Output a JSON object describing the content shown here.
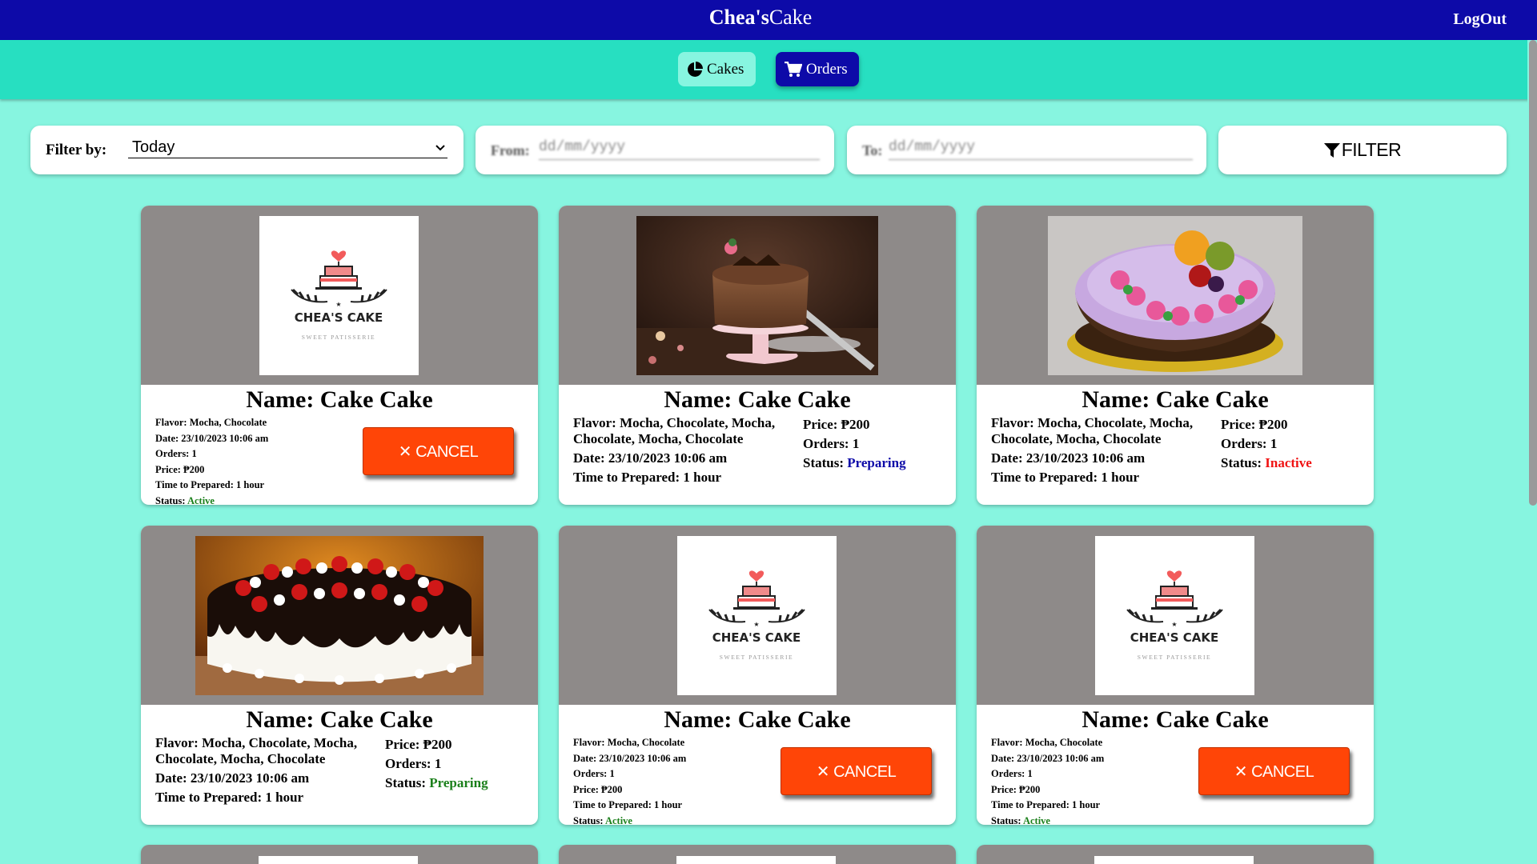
{
  "header": {
    "brand_bold": "Chea's",
    "brand_regular": "Cake",
    "logout_label": "LogOut"
  },
  "nav": {
    "cakes_label": "Cakes",
    "orders_label": "Orders"
  },
  "filters": {
    "filter_by_label": "Filter by:",
    "filter_by_value": "Today",
    "from_label": "From:",
    "from_placeholder": "dd/mm/yyyy",
    "to_label": "To:",
    "to_placeholder": "dd/mm/yyyy",
    "filter_button_label": "FILTER"
  },
  "logo": {
    "title": "CHEA'S CAKE",
    "subtitle": "SWEET PATISSERIE"
  },
  "cards": [
    {
      "name": "Name: Cake Cake",
      "image": "logo",
      "flavor": "Flavor: Mocha, Chocolate",
      "date": "Date: 23/10/2023 10:06 am",
      "orders": "Orders: 1",
      "price": "Price: ₱200",
      "time": "Time to Prepared: 1 hour",
      "status_label": "Status:",
      "status": "Active",
      "cancel_label": "✕ CANCEL"
    },
    {
      "name": "Name: Cake Cake",
      "image": "chocolate-mousse-cake",
      "flavor": "Flavor: Mocha, Chocolate, Mocha, Chocolate, Mocha, Chocolate",
      "date": "Date: 23/10/2023 10:06 am",
      "time": "Time to Prepared: 1 hour",
      "price": "Price: ₱200",
      "orders": "Orders: 1",
      "status_label": "Status:",
      "status": "Preparing",
      "status_color": "#0d0aa8"
    },
    {
      "name": "Name: Cake Cake",
      "image": "fruit-flower-cake",
      "flavor": "Flavor: Mocha, Chocolate, Mocha, Chocolate, Mocha, Chocolate",
      "date": "Date: 23/10/2023 10:06 am",
      "time": "Time to Prepared: 1 hour",
      "price": "Price: ₱200",
      "orders": "Orders: 1",
      "status_label": "Status:",
      "status": "Inactive",
      "status_color": "#f01212"
    },
    {
      "name": "Name: Cake Cake",
      "image": "strawberry-drip-cake",
      "flavor": "Flavor: Mocha, Chocolate, Mocha, Chocolate, Mocha, Chocolate",
      "date": "Date: 23/10/2023 10:06 am",
      "time": "Time to Prepared: 1 hour",
      "price": "Price: ₱200",
      "orders": "Orders: 1",
      "status_label": "Status:",
      "status": "Preparing",
      "status_color": "#1a7f1a"
    },
    {
      "name": "Name: Cake Cake",
      "image": "logo",
      "flavor": "Flavor: Mocha, Chocolate",
      "date": "Date: 23/10/2023 10:06 am",
      "orders": "Orders: 1",
      "price": "Price: ₱200",
      "time": "Time to Prepared: 1 hour",
      "status_label": "Status:",
      "status": "Active",
      "cancel_label": "✕ CANCEL"
    },
    {
      "name": "Name: Cake Cake",
      "image": "logo",
      "flavor": "Flavor: Mocha, Chocolate",
      "date": "Date: 23/10/2023 10:06 am",
      "orders": "Orders: 1",
      "price": "Price: ₱200",
      "time": "Time to Prepared: 1 hour",
      "status_label": "Status:",
      "status": "Active",
      "cancel_label": "✕ CANCEL"
    }
  ],
  "colors": {
    "header": "#0d0aa8",
    "navbar": "#27dfc1",
    "page": "#87f5e0",
    "cancel": "#ff4507"
  }
}
